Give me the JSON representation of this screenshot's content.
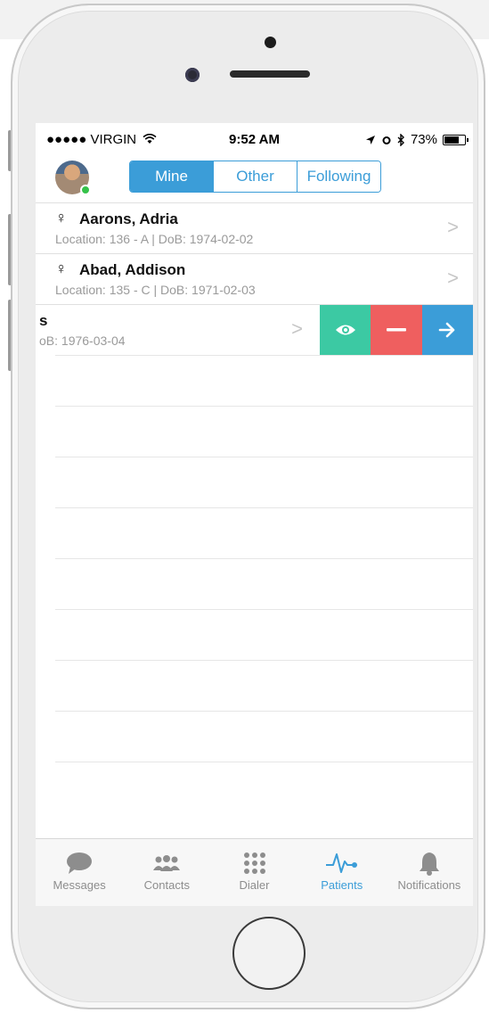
{
  "status_bar": {
    "carrier": "●●●●● VIRGIN",
    "time": "9:52 AM",
    "battery": "73%",
    "battery_level": 0.73
  },
  "segments": [
    {
      "label": "Mine",
      "active": true
    },
    {
      "label": "Other",
      "active": false
    },
    {
      "label": "Following",
      "active": false
    }
  ],
  "patients": [
    {
      "gender_symbol": "♀",
      "name": "Aarons, Adria",
      "details": "Location: 136 - A | DoB: 1974-02-02"
    },
    {
      "gender_symbol": "♀",
      "name": "Abad, Addison",
      "details": "Location: 135 - C | DoB: 1971-02-03"
    },
    {
      "name": "s",
      "details": "oB: 1976-03-04"
    }
  ],
  "swipe_actions": [
    {
      "icon": "eye-icon",
      "color": "#3cc9a3"
    },
    {
      "icon": "minus-icon",
      "color": "#ef5f5f"
    },
    {
      "icon": "arrow-right-icon",
      "color": "#3b9dd8"
    }
  ],
  "tabs": [
    {
      "label": "Messages",
      "icon": "speech-bubble-icon"
    },
    {
      "label": "Contacts",
      "icon": "people-icon"
    },
    {
      "label": "Dialer",
      "icon": "keypad-icon"
    },
    {
      "label": "Patients",
      "icon": "heartbeat-icon",
      "active": true
    },
    {
      "label": "Notifications",
      "icon": "bell-icon"
    }
  ],
  "colors": {
    "accent": "#3b9dd8",
    "view_action": "#3cc9a3",
    "remove_action": "#ef5f5f",
    "presence": "#35c24a"
  }
}
